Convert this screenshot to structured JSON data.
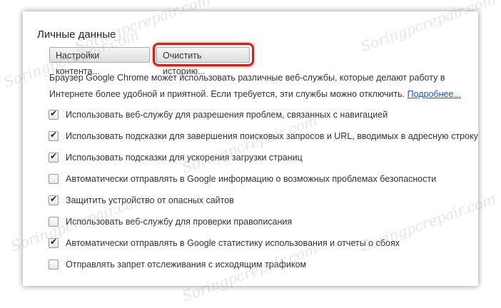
{
  "section": {
    "title": "Личные данные"
  },
  "buttons": {
    "content_settings": "Настройки контента...",
    "clear_history": "Очистить историю..."
  },
  "description": {
    "text": "Браузер Google Chrome может использовать различные веб-службы, которые делают работу в Интернете более удобной и приятной. Если требуется, эти службы можно отключить. ",
    "link": "Подробнее..."
  },
  "options": [
    {
      "label": "Использовать веб-службу для разрешения проблем, связанных с навигацией",
      "checked": true
    },
    {
      "label": "Использовать подсказки для завершения поисковых запросов и URL, вводимых в адресную строку",
      "checked": true
    },
    {
      "label": "Использовать подсказки для ускорения загрузки страниц",
      "checked": true
    },
    {
      "label": "Автоматически отправлять в Google информацию о возможных проблемах безопасности",
      "checked": false
    },
    {
      "label": "Защитить устройство от опасных сайтов",
      "checked": true
    },
    {
      "label": "Использовать веб-службу для проверки правописания",
      "checked": false
    },
    {
      "label": "Автоматически отправлять в Google статистику использования и отчеты о сбоях",
      "checked": true
    },
    {
      "label": "Отправлять запрет отслеживания с исходящим трафиком",
      "checked": false
    }
  ],
  "watermark": "Soringpcrepair.com",
  "colors": {
    "highlight": "#d3201c",
    "link": "#1155cc"
  }
}
